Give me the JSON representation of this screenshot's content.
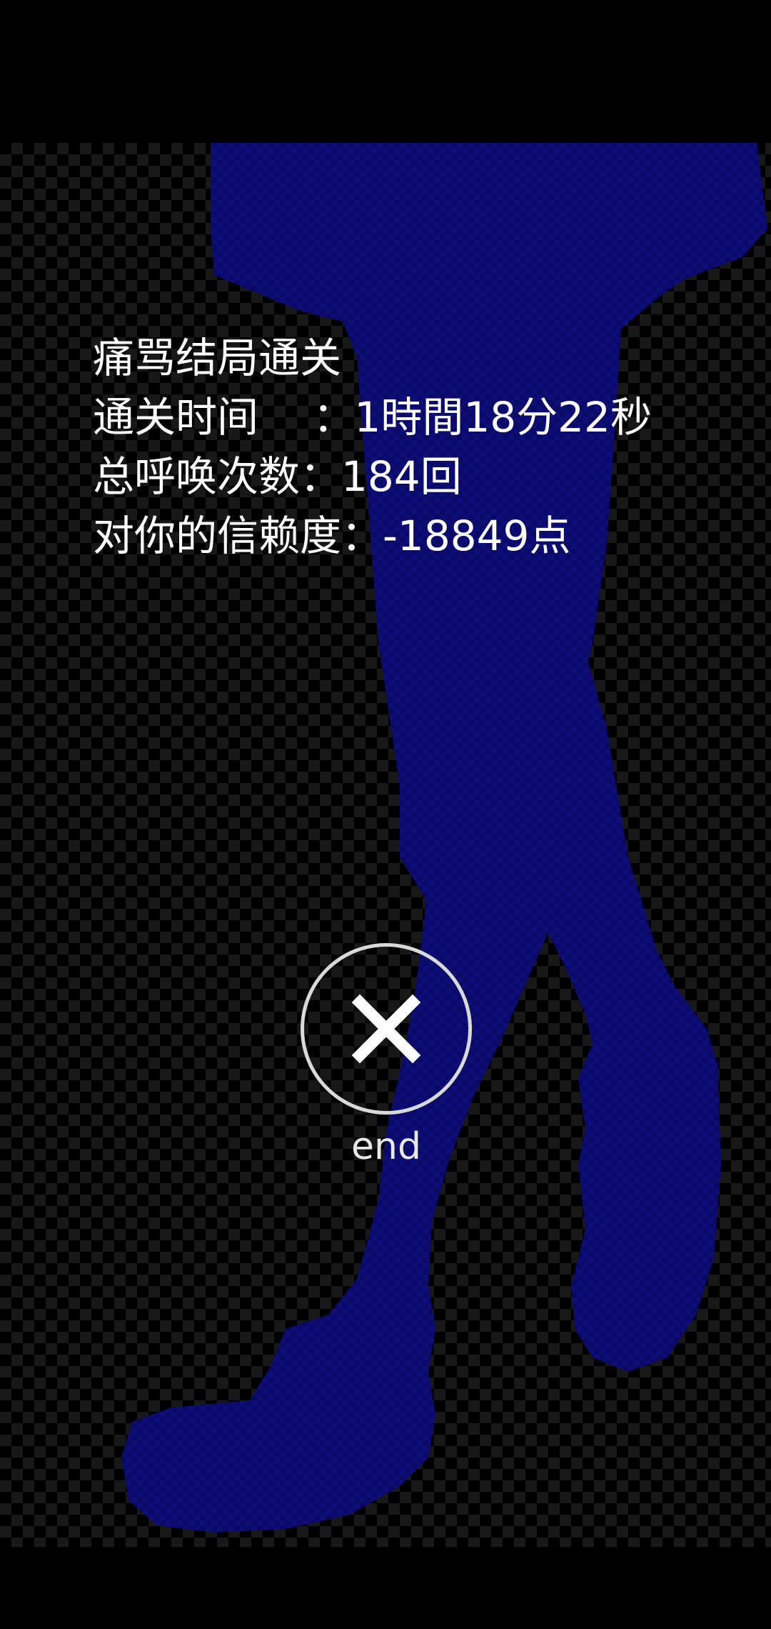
{
  "result": {
    "title": "痛骂结局通关",
    "clear_time": "通关时间　 ：1時間18分22秒",
    "call_count": "总呼唤次数：184回",
    "trust": "对你的信赖度：-18849点"
  },
  "end_button": {
    "label": "end",
    "icon": "close-icon"
  },
  "colors": {
    "silhouette": "#0c0c6a",
    "text": "#ffffff",
    "button_ring": "#d9d9d9"
  }
}
